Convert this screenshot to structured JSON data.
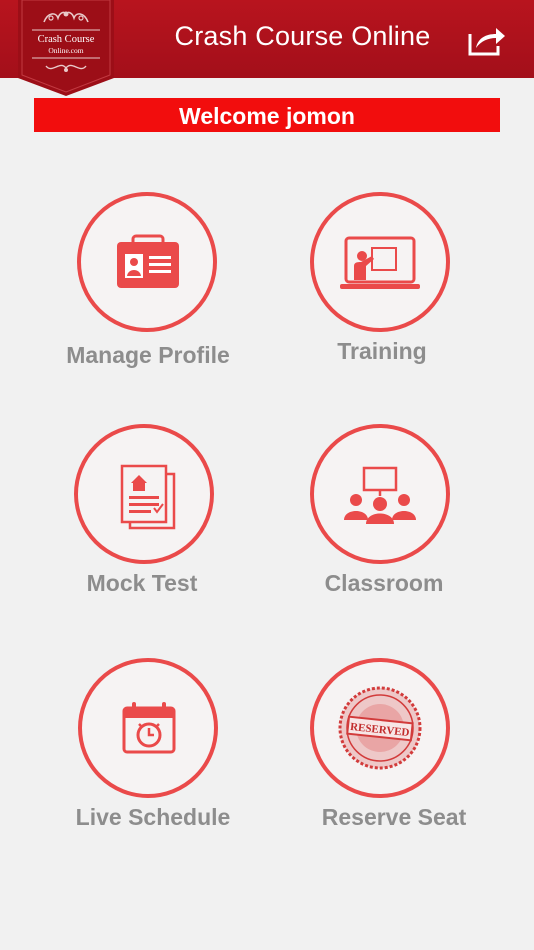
{
  "header": {
    "title": "Crash Course Online",
    "logo_line1": "Crash Course",
    "logo_line2": "Online.com",
    "share_icon": "share-icon"
  },
  "welcome": "Welcome jomon",
  "accent_color": "#ea4a4a",
  "menu": [
    {
      "label": "Manage Profile",
      "icon": "id-card-icon"
    },
    {
      "label": "Training",
      "icon": "presentation-icon"
    },
    {
      "label": "Mock Test",
      "icon": "documents-icon"
    },
    {
      "label": "Classroom",
      "icon": "classroom-icon"
    },
    {
      "label": "Live Schedule",
      "icon": "calendar-clock-icon"
    },
    {
      "label": "Reserve Seat",
      "icon": "reserved-stamp-icon"
    },
    {
      "stamp_text": "RESERVED"
    }
  ]
}
